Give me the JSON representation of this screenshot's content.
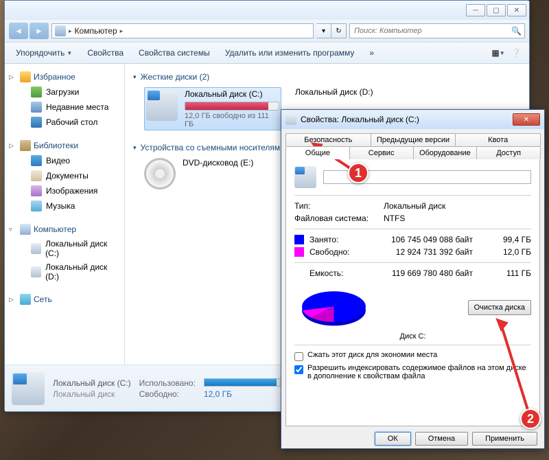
{
  "explorer": {
    "breadcrumb": "Компьютер",
    "search_placeholder": "Поиск: Компьютер",
    "toolbar": {
      "organize": "Упорядочить",
      "props": "Свойства",
      "sysprops": "Свойства системы",
      "uninstall": "Удалить или изменить программу"
    },
    "sidebar": {
      "favorites": {
        "label": "Избранное",
        "downloads": "Загрузки",
        "recent": "Недавние места",
        "desktop": "Рабочий стол"
      },
      "libraries": {
        "label": "Библиотеки",
        "video": "Видео",
        "docs": "Документы",
        "images": "Изображения",
        "music": "Музыка"
      },
      "computer": {
        "label": "Компьютер",
        "c": "Локальный диск (C:)",
        "d": "Локальный диск (D:)"
      },
      "network": "Сеть"
    },
    "content": {
      "hdd_label": "Жесткие диски (2)",
      "rem_label": "Устройства со съемными носителями",
      "drive_c": {
        "name": "Локальный диск (C:)",
        "free": "12,0 ГБ свободно из 111 ГБ",
        "pct": 89
      },
      "drive_d": {
        "name": "Локальный диск (D:)"
      },
      "dvd": {
        "name": "DVD-дисковод (E:)"
      }
    },
    "status": {
      "title": "Локальный диск (C:)",
      "subtitle": "Локальный диск",
      "used_lbl": "Использовано:",
      "free_lbl": "Свободно:",
      "free_val": "12,0 ГБ"
    }
  },
  "props": {
    "title": "Свойства: Локальный диск (C:)",
    "tabs": {
      "security": "Безопасность",
      "prev": "Предыдущие версии",
      "quota": "Квота",
      "general": "Общие",
      "service": "Сервис",
      "hardware": "Оборудование",
      "access": "Доступ"
    },
    "type_lbl": "Тип:",
    "type_val": "Локальный диск",
    "fs_lbl": "Файловая система:",
    "fs_val": "NTFS",
    "used_lbl": "Занято:",
    "used_bytes": "106 745 049 088 байт",
    "used_gb": "99,4 ГБ",
    "free_lbl": "Свободно:",
    "free_bytes": "12 924 731 392 байт",
    "free_gb": "12,0 ГБ",
    "cap_lbl": "Емкость:",
    "cap_bytes": "119 669 780 480 байт",
    "cap_gb": "111 ГБ",
    "pie_label": "Диск C:",
    "cleanup": "Очистка диска",
    "compress": "Сжать этот диск для экономии места",
    "index": "Разрешить индексировать содержимое файлов на этом диске в дополнение к свойствам файла",
    "ok": "ОК",
    "cancel": "Отмена",
    "apply": "Применить"
  },
  "callouts": {
    "c1": "1",
    "c2": "2"
  }
}
